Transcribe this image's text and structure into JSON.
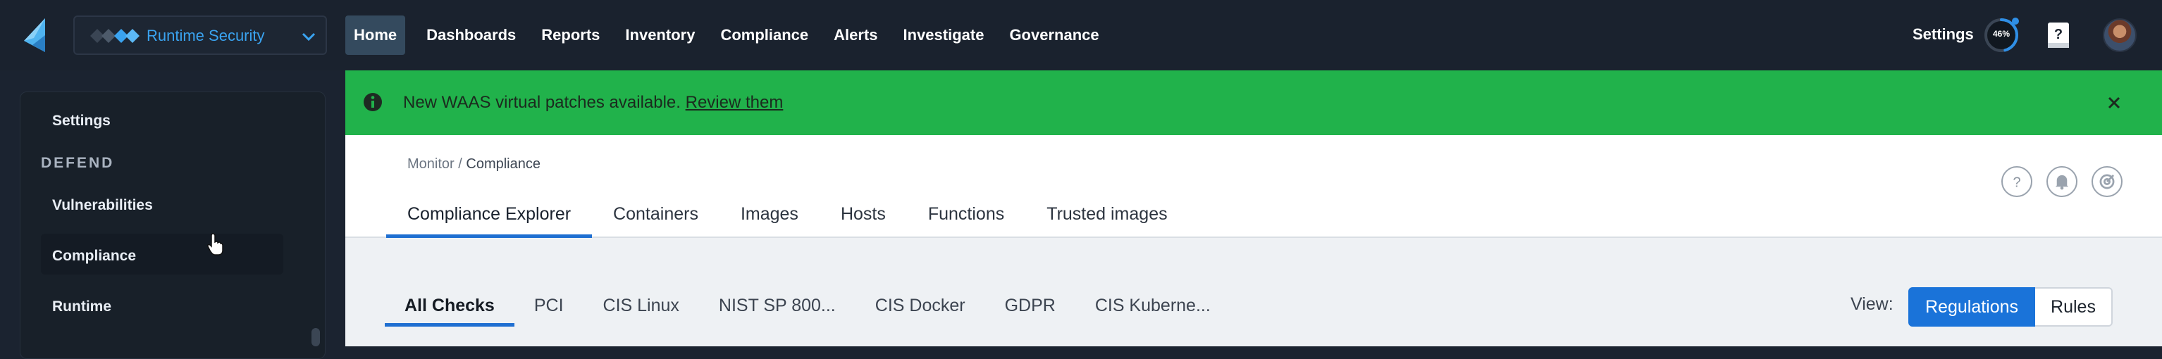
{
  "topnav": {
    "product": "Runtime Security",
    "items": [
      {
        "label": "Home",
        "active": true
      },
      {
        "label": "Dashboards"
      },
      {
        "label": "Reports"
      },
      {
        "label": "Inventory"
      },
      {
        "label": "Compliance"
      },
      {
        "label": "Alerts"
      },
      {
        "label": "Investigate"
      },
      {
        "label": "Governance"
      }
    ],
    "settings_label": "Settings",
    "progress_label": "46%",
    "progress_value": 0.46,
    "icons": [
      "logo-icon",
      "product-dots-icon",
      "chevron-down-icon",
      "progress-ring-icon",
      "help-book-icon",
      "avatar"
    ]
  },
  "sidebar": {
    "settings_label": "Settings",
    "section_defend": "DEFEND",
    "items": [
      {
        "label": "Vulnerabilities"
      },
      {
        "label": "Compliance",
        "active": true
      },
      {
        "label": "Runtime"
      }
    ]
  },
  "banner": {
    "message": "New WAAS virtual patches available.",
    "link": "Review them",
    "bg_color": "#21b24b"
  },
  "page": {
    "breadcrumb_parent": "Monitor /",
    "breadcrumb_current": "Compliance",
    "tabs": [
      {
        "label": "Compliance Explorer",
        "active": true
      },
      {
        "label": "Containers"
      },
      {
        "label": "Images"
      },
      {
        "label": "Hosts"
      },
      {
        "label": "Functions"
      },
      {
        "label": "Trusted images"
      }
    ],
    "header_icons": [
      "help-circle-icon",
      "bell-icon",
      "radar-icon"
    ]
  },
  "subbar": {
    "tabs": [
      {
        "label": "All Checks",
        "active": true
      },
      {
        "label": "PCI"
      },
      {
        "label": "CIS Linux"
      },
      {
        "label": "NIST SP 800..."
      },
      {
        "label": "CIS Docker"
      },
      {
        "label": "GDPR"
      },
      {
        "label": "CIS Kuberne..."
      }
    ],
    "view_label": "View:",
    "view_options": [
      {
        "label": "Regulations",
        "active": true
      },
      {
        "label": "Rules"
      }
    ],
    "accent": "#1a73d9"
  }
}
